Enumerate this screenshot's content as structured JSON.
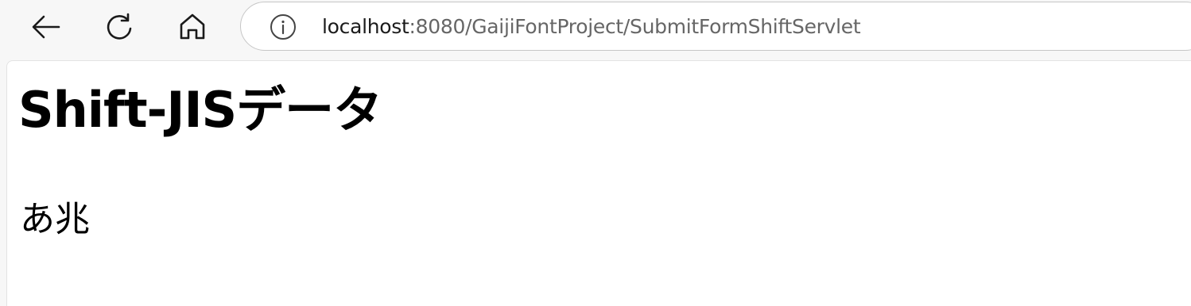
{
  "browser": {
    "back_icon": "arrow-left-icon",
    "reload_icon": "reload-icon",
    "home_icon": "home-icon",
    "site_info_icon": "info-icon",
    "url_host": "localhost",
    "url_path": ":8080/GaijiFontProject/SubmitFormShiftServlet"
  },
  "page": {
    "title": "Shift-JISデータ",
    "data_text": "あ兆"
  }
}
